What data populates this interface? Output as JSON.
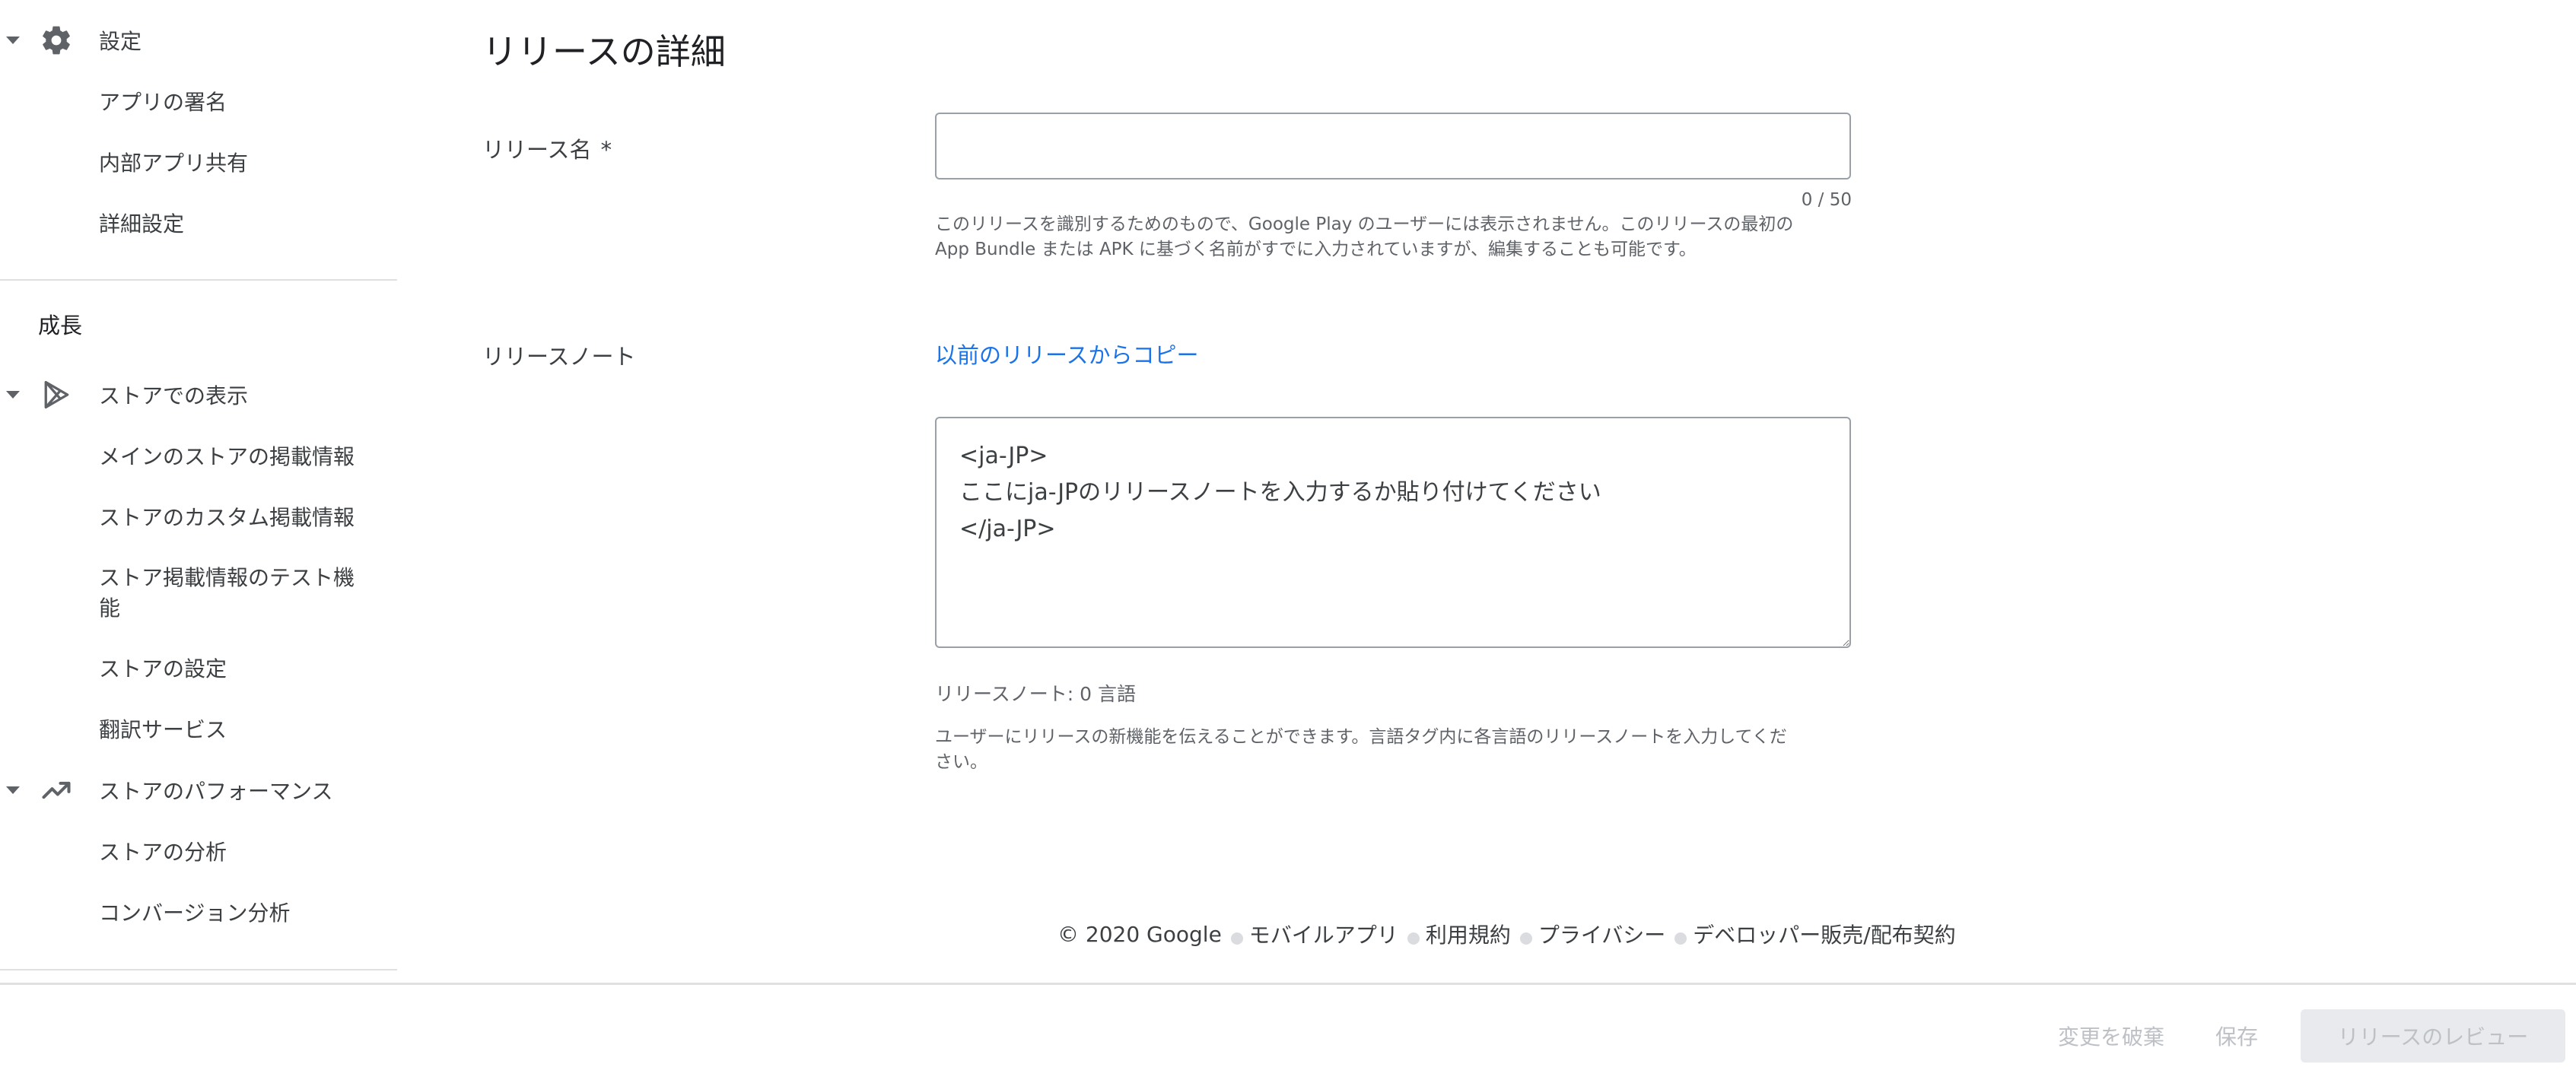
{
  "sidebar": {
    "settings": {
      "label": "設定",
      "icon": "gear-icon"
    },
    "settings_items": [
      "アプリの署名",
      "内部アプリ共有",
      "詳細設定"
    ],
    "growth_title": "成長",
    "store_presence": {
      "label": "ストアでの表示",
      "icon": "play-store-icon"
    },
    "store_presence_items": [
      "メインのストアの掲載情報",
      "ストアのカスタム掲載情報",
      "ストア掲載情報のテスト機能",
      "ストアの設定",
      "翻訳サービス"
    ],
    "store_performance": {
      "label": "ストアのパフォーマンス",
      "icon": "trending-up-icon"
    },
    "store_performance_items": [
      "ストアの分析",
      "コンバージョン分析"
    ]
  },
  "main": {
    "title": "リリースの詳細",
    "release_name": {
      "label": "リリース名",
      "required_marker": "*",
      "value": "",
      "counter": "0 / 50",
      "helper_line1": "このリリースを識別するためのもので、Google Play のユーザーには表示されません。このリリースの最初の",
      "helper_line2": "App Bundle または APK に基づく名前がすでに入力されていますが、編集することも可能です。"
    },
    "release_notes": {
      "label": "リリースノート",
      "copy_link": "以前のリリースからコピー",
      "value": "<ja-JP>\nここにja-JPのリリースノートを入力するか貼り付けてください\n</ja-JP>",
      "count": "リリースノート: 0 言語",
      "helper_line1": "ユーザーにリリースの新機能を伝えることができます。言語タグ内に各言語のリリースノートを入力してくだ",
      "helper_line2": "さい。"
    }
  },
  "footer": {
    "copyright": "© 2020 Google",
    "links": [
      "モバイルアプリ",
      "利用規約",
      "プライバシー",
      "デベロッパー販売/配布契約"
    ]
  },
  "actions": {
    "discard": "変更を破棄",
    "save": "保存",
    "review": "リリースのレビュー"
  },
  "colors": {
    "link": "#1a73e8",
    "disabled_text": "#bdc1c6",
    "disabled_bg": "#e8eaed",
    "border": "#9aa0a6"
  }
}
